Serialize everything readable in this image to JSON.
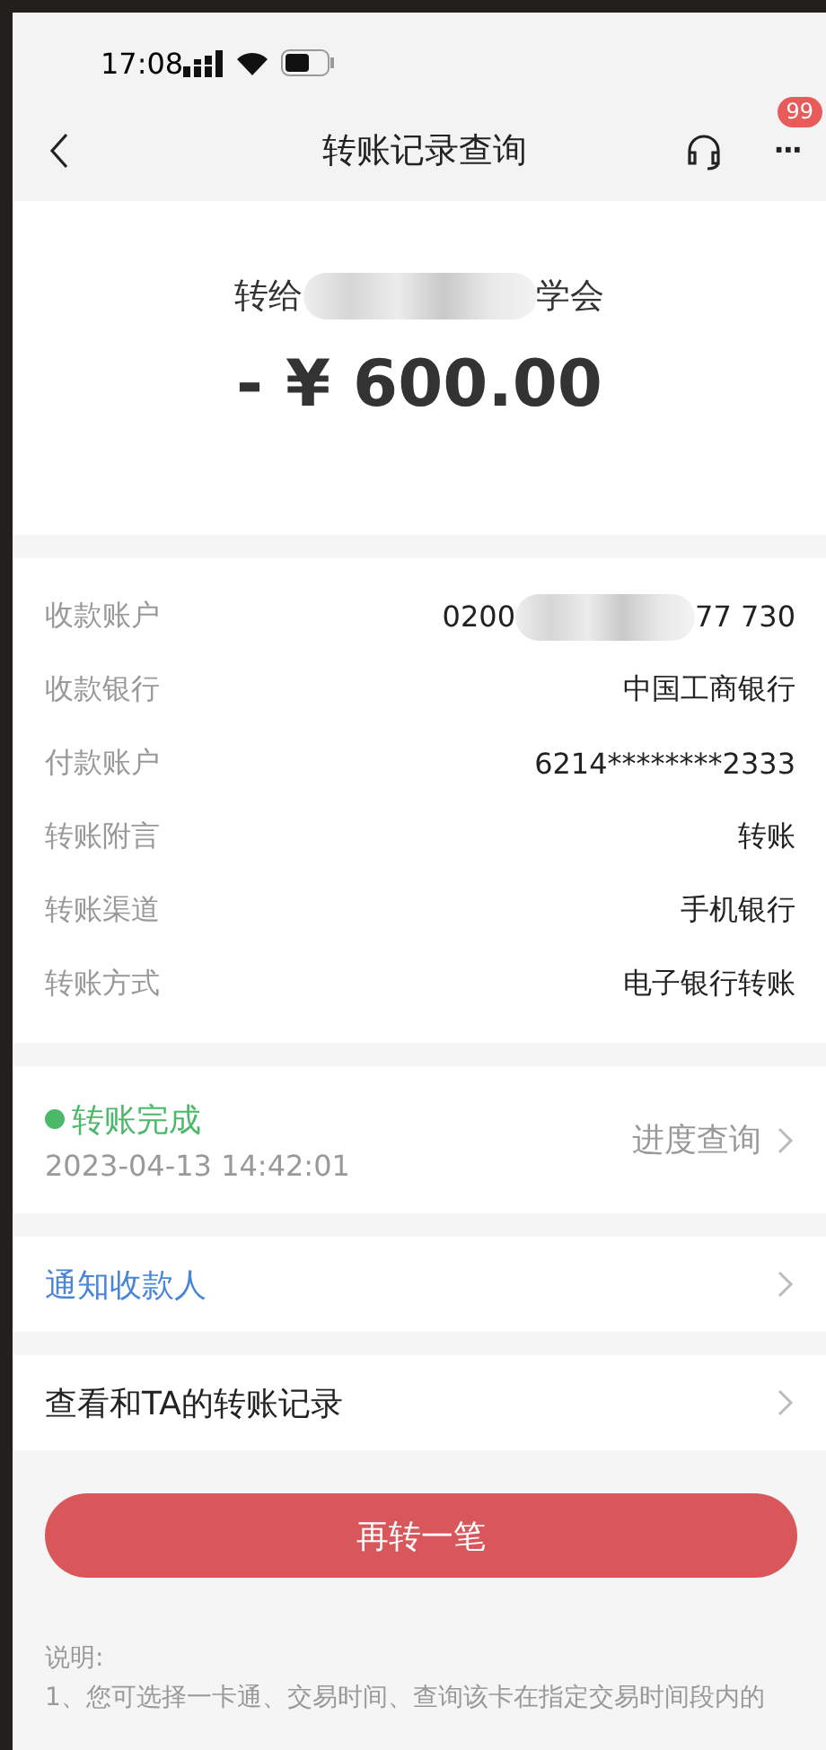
{
  "status_bar": {
    "time": "17:08"
  },
  "nav": {
    "title": "转账记录查询",
    "more": "···",
    "badge": "99"
  },
  "summary": {
    "recipient_prefix": "转给",
    "recipient_suffix": "学会",
    "amount": "- ¥ 600.00"
  },
  "details": [
    {
      "label": "收款账户",
      "value_start": "0200",
      "value_end": "77 730"
    },
    {
      "label": "收款银行",
      "value_start": "中国工商银行"
    },
    {
      "label": "付款账户",
      "value_start": "6214********2333"
    },
    {
      "label": "转账附言",
      "value_start": "转账"
    },
    {
      "label": "转账渠道",
      "value_start": "手机银行"
    },
    {
      "label": "转账方式",
      "value_start": "电子银行转账"
    }
  ],
  "status": {
    "text": "转账完成",
    "color": "#4cb96a",
    "time": "2023-04-13 14:42:01",
    "link": "进度查询"
  },
  "links": [
    {
      "label": "通知收款人",
      "kind": "highlight"
    },
    {
      "label": "查看和TA的转账记录",
      "kind": "plain"
    }
  ],
  "button": "再转一笔",
  "notes": {
    "title": "说明:",
    "lines": [
      "1、您可选择一卡通、交易时间、查询该卡在指定交易时间段内的"
    ]
  }
}
